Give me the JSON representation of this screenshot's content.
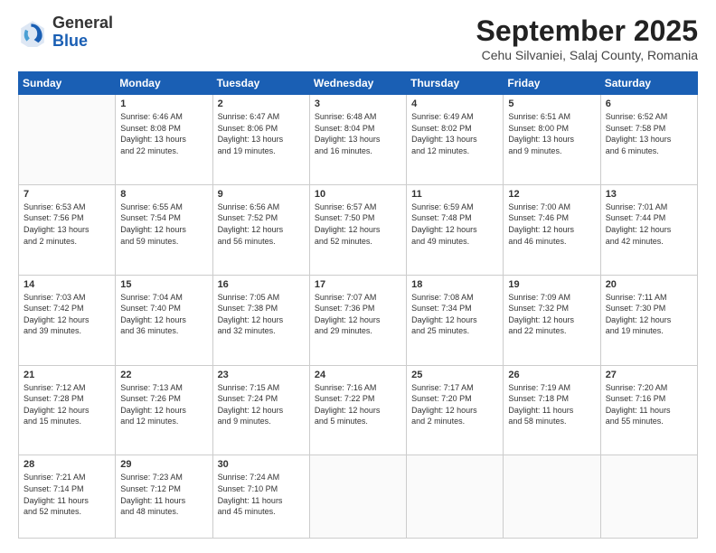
{
  "header": {
    "logo_line1": "General",
    "logo_line2": "Blue",
    "title": "September 2025",
    "subtitle": "Cehu Silvaniei, Salaj County, Romania"
  },
  "weekdays": [
    "Sunday",
    "Monday",
    "Tuesday",
    "Wednesday",
    "Thursday",
    "Friday",
    "Saturday"
  ],
  "weeks": [
    [
      {
        "day": "",
        "info": ""
      },
      {
        "day": "1",
        "info": "Sunrise: 6:46 AM\nSunset: 8:08 PM\nDaylight: 13 hours\nand 22 minutes."
      },
      {
        "day": "2",
        "info": "Sunrise: 6:47 AM\nSunset: 8:06 PM\nDaylight: 13 hours\nand 19 minutes."
      },
      {
        "day": "3",
        "info": "Sunrise: 6:48 AM\nSunset: 8:04 PM\nDaylight: 13 hours\nand 16 minutes."
      },
      {
        "day": "4",
        "info": "Sunrise: 6:49 AM\nSunset: 8:02 PM\nDaylight: 13 hours\nand 12 minutes."
      },
      {
        "day": "5",
        "info": "Sunrise: 6:51 AM\nSunset: 8:00 PM\nDaylight: 13 hours\nand 9 minutes."
      },
      {
        "day": "6",
        "info": "Sunrise: 6:52 AM\nSunset: 7:58 PM\nDaylight: 13 hours\nand 6 minutes."
      }
    ],
    [
      {
        "day": "7",
        "info": "Sunrise: 6:53 AM\nSunset: 7:56 PM\nDaylight: 13 hours\nand 2 minutes."
      },
      {
        "day": "8",
        "info": "Sunrise: 6:55 AM\nSunset: 7:54 PM\nDaylight: 12 hours\nand 59 minutes."
      },
      {
        "day": "9",
        "info": "Sunrise: 6:56 AM\nSunset: 7:52 PM\nDaylight: 12 hours\nand 56 minutes."
      },
      {
        "day": "10",
        "info": "Sunrise: 6:57 AM\nSunset: 7:50 PM\nDaylight: 12 hours\nand 52 minutes."
      },
      {
        "day": "11",
        "info": "Sunrise: 6:59 AM\nSunset: 7:48 PM\nDaylight: 12 hours\nand 49 minutes."
      },
      {
        "day": "12",
        "info": "Sunrise: 7:00 AM\nSunset: 7:46 PM\nDaylight: 12 hours\nand 46 minutes."
      },
      {
        "day": "13",
        "info": "Sunrise: 7:01 AM\nSunset: 7:44 PM\nDaylight: 12 hours\nand 42 minutes."
      }
    ],
    [
      {
        "day": "14",
        "info": "Sunrise: 7:03 AM\nSunset: 7:42 PM\nDaylight: 12 hours\nand 39 minutes."
      },
      {
        "day": "15",
        "info": "Sunrise: 7:04 AM\nSunset: 7:40 PM\nDaylight: 12 hours\nand 36 minutes."
      },
      {
        "day": "16",
        "info": "Sunrise: 7:05 AM\nSunset: 7:38 PM\nDaylight: 12 hours\nand 32 minutes."
      },
      {
        "day": "17",
        "info": "Sunrise: 7:07 AM\nSunset: 7:36 PM\nDaylight: 12 hours\nand 29 minutes."
      },
      {
        "day": "18",
        "info": "Sunrise: 7:08 AM\nSunset: 7:34 PM\nDaylight: 12 hours\nand 25 minutes."
      },
      {
        "day": "19",
        "info": "Sunrise: 7:09 AM\nSunset: 7:32 PM\nDaylight: 12 hours\nand 22 minutes."
      },
      {
        "day": "20",
        "info": "Sunrise: 7:11 AM\nSunset: 7:30 PM\nDaylight: 12 hours\nand 19 minutes."
      }
    ],
    [
      {
        "day": "21",
        "info": "Sunrise: 7:12 AM\nSunset: 7:28 PM\nDaylight: 12 hours\nand 15 minutes."
      },
      {
        "day": "22",
        "info": "Sunrise: 7:13 AM\nSunset: 7:26 PM\nDaylight: 12 hours\nand 12 minutes."
      },
      {
        "day": "23",
        "info": "Sunrise: 7:15 AM\nSunset: 7:24 PM\nDaylight: 12 hours\nand 9 minutes."
      },
      {
        "day": "24",
        "info": "Sunrise: 7:16 AM\nSunset: 7:22 PM\nDaylight: 12 hours\nand 5 minutes."
      },
      {
        "day": "25",
        "info": "Sunrise: 7:17 AM\nSunset: 7:20 PM\nDaylight: 12 hours\nand 2 minutes."
      },
      {
        "day": "26",
        "info": "Sunrise: 7:19 AM\nSunset: 7:18 PM\nDaylight: 11 hours\nand 58 minutes."
      },
      {
        "day": "27",
        "info": "Sunrise: 7:20 AM\nSunset: 7:16 PM\nDaylight: 11 hours\nand 55 minutes."
      }
    ],
    [
      {
        "day": "28",
        "info": "Sunrise: 7:21 AM\nSunset: 7:14 PM\nDaylight: 11 hours\nand 52 minutes."
      },
      {
        "day": "29",
        "info": "Sunrise: 7:23 AM\nSunset: 7:12 PM\nDaylight: 11 hours\nand 48 minutes."
      },
      {
        "day": "30",
        "info": "Sunrise: 7:24 AM\nSunset: 7:10 PM\nDaylight: 11 hours\nand 45 minutes."
      },
      {
        "day": "",
        "info": ""
      },
      {
        "day": "",
        "info": ""
      },
      {
        "day": "",
        "info": ""
      },
      {
        "day": "",
        "info": ""
      }
    ]
  ]
}
